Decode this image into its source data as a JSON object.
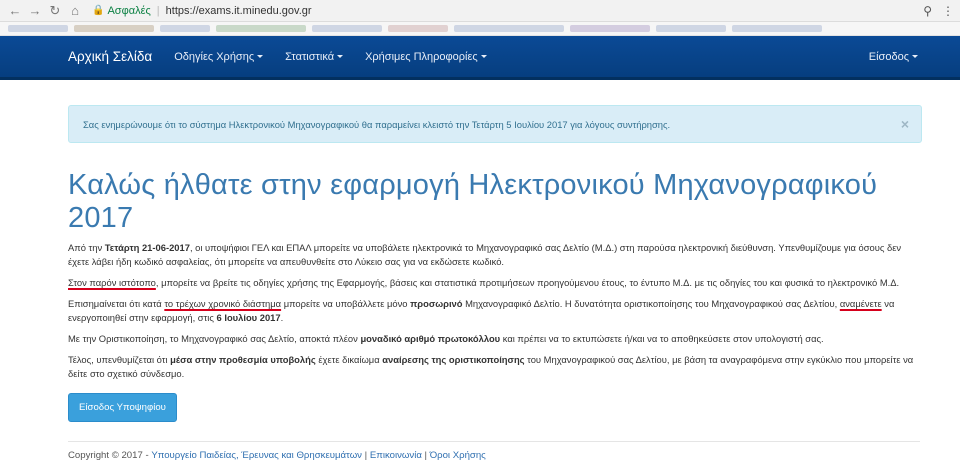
{
  "browser": {
    "secure_label": "Ασφαλές",
    "url": "https://exams.it.minedu.gov.gr"
  },
  "navbar": {
    "brand": "Αρχική Σελίδα",
    "items": [
      {
        "label": "Οδηγίες Χρήσης"
      },
      {
        "label": "Στατιστικά"
      },
      {
        "label": "Χρήσιμες Πληροφορίες"
      }
    ],
    "login": "Είσοδος"
  },
  "alert": {
    "text": "Σας ενημερώνουμε ότι το σύστημα Ηλεκτρονικού Μηχανογραφικού θα παραμείνει κλειστό την Τετάρτη 5 Ιουλίου 2017 για λόγους συντήρησης.",
    "close": "×"
  },
  "main": {
    "title": "Καλώς ήλθατε στην εφαρμογή Ηλεκτρονικού Μηχανογραφικού 2017",
    "p1": {
      "a": "Από την ",
      "b": "Τετάρτη 21-06-2017",
      "c": ", οι υποψήφιοι ΓΕΛ και ΕΠΑΛ μπορείτε να υποβάλετε ηλεκτρονικά το Μηχανογραφικό σας Δελτίο (Μ.Δ.) στη παρούσα ηλεκτρονική διεύθυνση. Υπενθυμίζουμε για όσους δεν έχετε λάβει ήδη κωδικό ασφαλείας, ότι μπορείτε να απευθυνθείτε στο Λύκειο σας για να εκδώσετε κωδικό."
    },
    "p2": {
      "a": "Στον παρόν ιστότοπο",
      "b": ", μπορείτε να βρείτε τις οδηγίες χρήσης της Εφαρμογής, βάσεις και στατιστικά προτιμήσεων προηγούμενου έτους, το έντυπο Μ.Δ. με τις οδηγίες του και φυσικά το ηλεκτρονικό Μ.Δ."
    },
    "p3": {
      "a": "Επισημαίνεται ότι κατά ",
      "b": "το τρέχων χρονικό διάστημα",
      "c": " μπορείτε να υποβάλλετε μόνο ",
      "d": "προσωρινό",
      "e": " Μηχανογραφικό Δελτίο. Η δυνατότητα οριστικοποίησης του Μηχανογραφικού σας Δελτίου, ",
      "f": "αναμένετε",
      "g": " να ενεργοποιηθεί στην εφαρμογή, στις ",
      "h": "6 Ιουλίου 2017",
      "i": "."
    },
    "p4": {
      "a": "Με την Οριστικοποίηση, το Μηχανογραφικό σας Δελτίο, αποκτά πλέον ",
      "b": "μοναδικό αριθμό πρωτοκόλλου",
      "c": " και πρέπει να το εκτυπώσετε ή/και να το αποθηκεύσετε στον υπολογιστή σας."
    },
    "p5": {
      "a": "Τέλος, υπενθυμίζεται ότι ",
      "b": "μέσα στην προθεσμία υποβολής",
      "c": " έχετε δικαίωμα ",
      "d": "αναίρεσης της οριστικοποίησης",
      "e": " του Μηχανογραφικού σας Δελτίου, με βάση τα αναγραφόμενα στην εγκύκλιο που μπορείτε να δείτε στο σχετικό σύνδεσμο."
    },
    "button": "Είσοδος Υποψηφίου"
  },
  "footer": {
    "copyright": "Copyright © 2017 - ",
    "ministry": "Υπουργείο Παιδείας, Έρευνας και Θρησκευμάτων",
    "sep": " | ",
    "contact": "Επικοινωνία",
    "terms": "Όροι Χρήσης"
  }
}
